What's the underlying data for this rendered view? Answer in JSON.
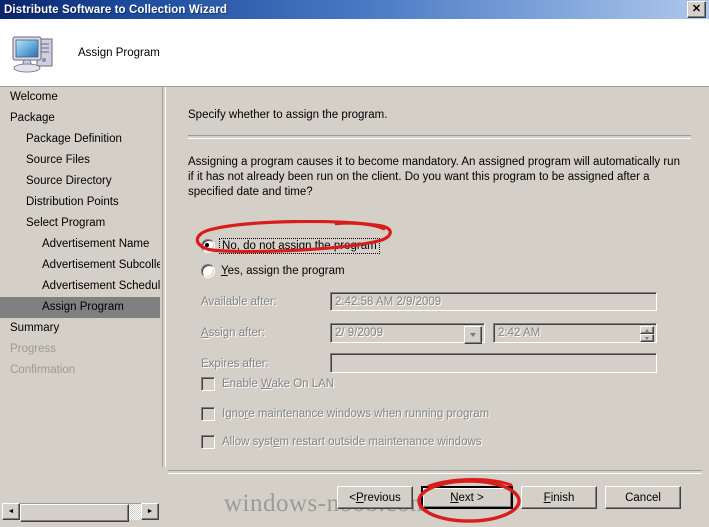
{
  "window": {
    "title": "Distribute Software to Collection Wizard",
    "close_label": "✕"
  },
  "header": {
    "icon": "computer-icon",
    "title": "Assign Program"
  },
  "sidebar": {
    "items": [
      {
        "label": "Welcome",
        "level": 1,
        "state": "normal"
      },
      {
        "label": "Package",
        "level": 1,
        "state": "normal"
      },
      {
        "label": "Package Definition",
        "level": 2,
        "state": "normal"
      },
      {
        "label": "Source Files",
        "level": 2,
        "state": "normal"
      },
      {
        "label": "Source Directory",
        "level": 2,
        "state": "normal"
      },
      {
        "label": "Distribution Points",
        "level": 2,
        "state": "normal"
      },
      {
        "label": "Select Program",
        "level": 2,
        "state": "normal"
      },
      {
        "label": "Advertisement Name",
        "level": 3,
        "state": "normal"
      },
      {
        "label": "Advertisement Subcollec",
        "level": 3,
        "state": "normal"
      },
      {
        "label": "Advertisement Schedule",
        "level": 3,
        "state": "normal"
      },
      {
        "label": "Assign Program",
        "level": 3,
        "state": "current"
      },
      {
        "label": "Summary",
        "level": 1,
        "state": "normal"
      },
      {
        "label": "Progress",
        "level": 1,
        "state": "dim"
      },
      {
        "label": "Confirmation",
        "level": 1,
        "state": "dim"
      }
    ],
    "scrollbar": {
      "left_arrow": "◄",
      "right_arrow": "►"
    }
  },
  "main": {
    "instruction": "Specify whether to assign the program.",
    "description": "Assigning a program causes it to become mandatory. An assigned program will automatically run if it has not already been run on the client. Do you want this program to be assigned after a specified date and time?",
    "radios": [
      {
        "label_pre": "N",
        "label_key": "o",
        "label_post": ", do not assign the program",
        "checked": true,
        "focused": true
      },
      {
        "label_pre": "",
        "label_key": "Y",
        "label_post": "es, assign the program",
        "checked": false,
        "focused": false
      }
    ],
    "fields": [
      {
        "label": "Available after:",
        "value": "2:42:58 AM 2/9/2009",
        "type": "text",
        "enabled": false
      },
      {
        "label": "Assign after:",
        "label_key": "A",
        "value": "2/  9/2009",
        "type": "combo",
        "enabled": false
      },
      {
        "label": "",
        "value": "2:42 AM",
        "type": "spinner",
        "enabled": false
      },
      {
        "label": "Expires after:",
        "value": "",
        "type": "text",
        "enabled": false
      }
    ],
    "checkboxes": [
      {
        "pre": "Enable ",
        "key": "W",
        "post": "ake On LAN",
        "checked": false,
        "enabled": false
      },
      {
        "pre": "Igno",
        "key": "r",
        "post": "e maintenance windows when running program",
        "checked": false,
        "enabled": false
      },
      {
        "pre": "Allow syst",
        "key": "e",
        "post": "m restart outside maintenance windows",
        "checked": false,
        "enabled": false
      }
    ]
  },
  "footer": {
    "buttons": [
      {
        "pre": "< ",
        "key": "P",
        "post": "revious",
        "default": false
      },
      {
        "pre": "",
        "key": "N",
        "post": "ext >",
        "default": true
      },
      {
        "pre": "",
        "key": "F",
        "post": "inish",
        "default": false
      },
      {
        "pre": "Cancel",
        "key": "",
        "post": "",
        "default": false
      }
    ]
  },
  "watermark": {
    "text": "windows-noob.com"
  },
  "annotations": {
    "color": "#d81d1d",
    "marks": [
      "ellipse-around-no-radio",
      "ellipse-around-next-button"
    ]
  },
  "colors": {
    "face": "#d4d0c8",
    "title_start": "#0a246a",
    "title_end": "#b0c8ec",
    "highlight": "#808080",
    "annotation_red": "#d81d1d"
  }
}
